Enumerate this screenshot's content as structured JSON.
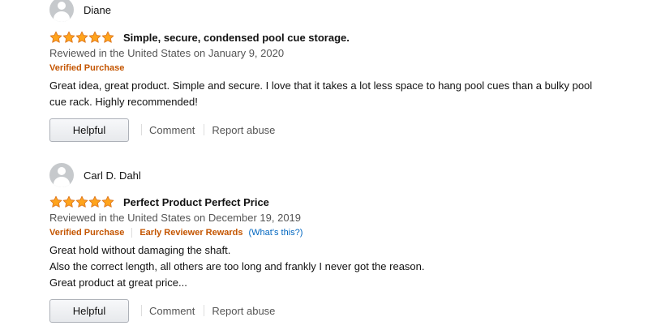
{
  "reviews": [
    {
      "profile_name": "Diane",
      "rating": 5,
      "title": "Simple, secure, condensed pool cue storage.",
      "date": "Reviewed in the United States on January 9, 2020",
      "badges": [
        "Verified Purchase"
      ],
      "whats_this": "",
      "body": [
        "Great idea, great product. Simple and secure. I love that it takes a lot less space to hang pool cues than a bulky pool",
        "cue rack. Highly recommended!"
      ],
      "helpful_label": "Helpful",
      "comment_label": "Comment",
      "report_label": "Report abuse"
    },
    {
      "profile_name": "Carl D. Dahl",
      "rating": 5,
      "title": "Perfect Product Perfect Price",
      "date": "Reviewed in the United States on December 19, 2019",
      "badges": [
        "Verified Purchase",
        "Early Reviewer Rewards"
      ],
      "whats_this": "(What's this?)",
      "body": [
        "Great hold without damaging the shaft.",
        "Also the correct length, all others are too long and frankly I never got the reason.",
        "Great product at great price..."
      ],
      "helpful_label": "Helpful",
      "comment_label": "Comment",
      "report_label": "Report abuse"
    }
  ],
  "colors": {
    "star": "#ffa41c",
    "star_outline": "#de7921",
    "badge": "#c45500",
    "link": "#0066c0",
    "meta": "#555555"
  },
  "icons": {
    "avatar": "default-profile-avatar-icon",
    "star": "star-icon"
  }
}
